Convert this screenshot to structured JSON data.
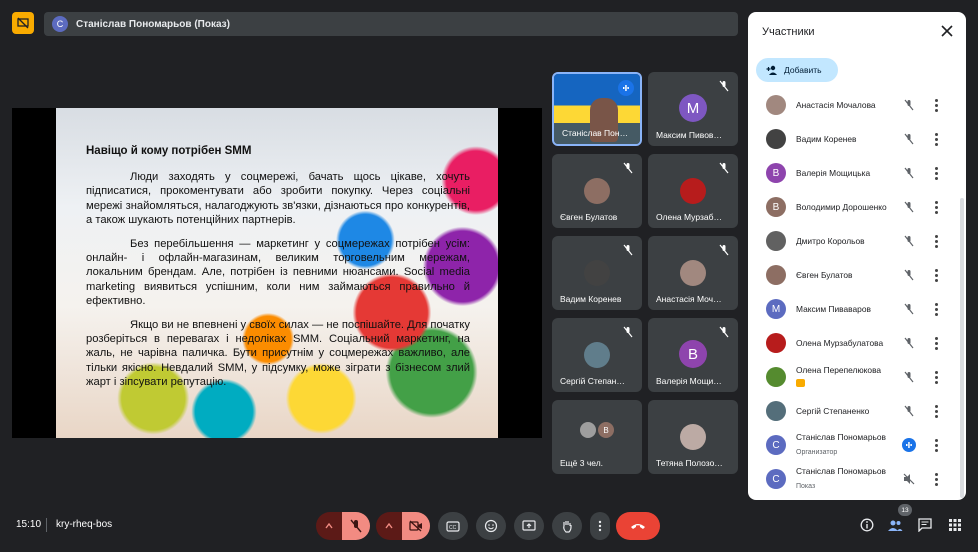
{
  "presenter_bar": {
    "avatar_letter": "С",
    "title": "Станіслав Пономарьов (Показ)"
  },
  "slide": {
    "title": "Навіщо й кому потрібен SMM",
    "paragraphs": [
      "Люди заходять у соцмережі, бачать щось цікаве, хочуть підписатися, прокоментувати або зробити покупку. Через соціальні мережі знайомляться, налагоджують зв'язки, дізнаються про конкурентів, а також шукають потенційних партнерів.",
      "Без перебільшення — маркетинг у соцмережах потрібен усім: онлайн- і офлайн-магазинам, великим торговельним мережам, локальним брендам. Але, потрібен із певними нюансами. Social media marketing виявиться успішним, коли ним займаються правильно й ефективно.",
      "Якщо ви не впевнені у своїх силах — не поспішайте. Для початку розберіться в перевагах і недоліках SMM. Соціальний маркетинг, на жаль, не чарівна паличка. Бути присутнім у соцмережах важливо, але тільки якісно. Невдалий SMM, у підсумку, може зіграти з бізнесом злий жарт і зіпсувати репутацію."
    ]
  },
  "tiles": [
    {
      "name": "Станіслав Пон…",
      "kind": "speaker"
    },
    {
      "name": "Максим Пивов…",
      "letter": "М",
      "color": "#7e57c2"
    },
    {
      "name": "Євген Булатов",
      "photo": "#8d6e63"
    },
    {
      "name": "Олена Мурзаб…",
      "photo": "#b71c1c"
    },
    {
      "name": "Вадим Коренев",
      "photo": "#424242"
    },
    {
      "name": "Анастасія Моч…",
      "photo": "#a1887f"
    },
    {
      "name": "Сергій Степан…",
      "photo": "#607d8b"
    },
    {
      "name": "Валерія Мощи…",
      "letter": "В",
      "color": "#8e44ad"
    },
    {
      "name": "Ещё 3 чел.",
      "kind": "more"
    },
    {
      "name": "Тетяна Полозо…",
      "photo": "#bcaaa4"
    }
  ],
  "panel": {
    "title": "Участники",
    "add_label": "Добавить",
    "participants": [
      {
        "name": "Анастасія Мочалова",
        "color": "#a1887f",
        "muted": true
      },
      {
        "name": "Вадим Коренев",
        "color": "#424242",
        "muted": true
      },
      {
        "name": "Валерія Мощицька",
        "letter": "В",
        "color": "#8e44ad",
        "muted": true
      },
      {
        "name": "Володимир Дорошенко",
        "letter": "В",
        "color": "#8d6e63",
        "muted": true
      },
      {
        "name": "Дмитро Корольов",
        "color": "#616161",
        "muted": true
      },
      {
        "name": "Євген Булатов",
        "color": "#8d6e63",
        "muted": true
      },
      {
        "name": "Максим Пиваваров",
        "letter": "М",
        "color": "#5c6bc0",
        "muted": true
      },
      {
        "name": "Олена Мурзабулатова",
        "color": "#b71c1c",
        "muted": true
      },
      {
        "name": "Олена Перепелюкова",
        "color": "#558b2f",
        "muted": true
      },
      {
        "name": "Сергій Степаненко",
        "color": "#546e7a",
        "muted": true
      },
      {
        "name": "Станіслав Пономарьов",
        "letter": "С",
        "color": "#5c6bc0",
        "sub": "Организатор",
        "speaking": true
      },
      {
        "name": "Станіслав Пономарьов",
        "letter": "С",
        "color": "#5c6bc0",
        "sub": "Показ",
        "muted": true
      }
    ]
  },
  "bottom": {
    "time": "15:10",
    "meeting_code": "kry-rheq-bos",
    "participant_count": "13"
  },
  "colors": {
    "accent": "#1a73e8",
    "danger": "#ea4335",
    "muted_bg": "#f28b82"
  }
}
